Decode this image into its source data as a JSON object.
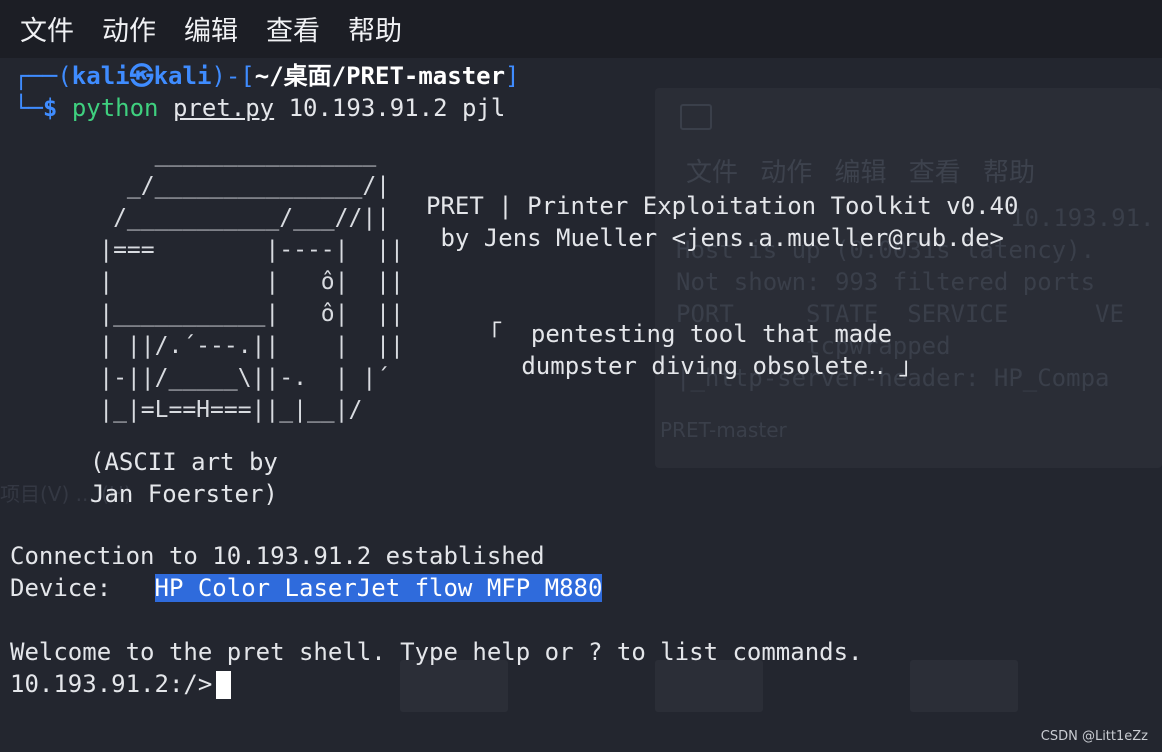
{
  "menu": [
    "文件",
    "动作",
    "编辑",
    "查看",
    "帮助"
  ],
  "prompt": {
    "open": "┌──(",
    "user": "kali",
    "at_icon": "㉿",
    "host": "kali",
    "mid": ")-[",
    "path": "~/桌面/PRET-master",
    "close": "]",
    "corner": "└─",
    "dollar": "$",
    "command": "python",
    "script": "pret.py",
    "args": "10.193.91.2 pjl"
  },
  "ascii_art": "         ________________\n       _/_______________/|\n      /___________/___//||\n     |===        |----|  ||\n     |           |   ô|  ||\n     |___________|   ô|  ||\n     | ||/.´---.||    |  ||\n     |-||/_____\\||-.  | |´\n     |_|=L==H===||_|__|/",
  "banner": {
    "title": "PRET | Printer Exploitation Toolkit v0.40",
    "author": " by Jens Mueller <jens.a.mueller@rub.de>"
  },
  "quote": {
    "line1": "「  pentesting tool that made",
    "line2": "   dumpster diving obsolete‥ 」"
  },
  "credit": {
    "line1": "(ASCII art by",
    "line2": "Jan Foerster)"
  },
  "connection": "Connection to 10.193.91.2 established",
  "device": {
    "label": "Device:   ",
    "value": "HP Color LaserJet flow MFP M880"
  },
  "welcome": "Welcome to the pret shell. Type help or ? to list commands.",
  "shell_prompt": "10.193.91.2:/>",
  "watermark": "CSDN @Litt1eZz",
  "background_window": {
    "menu": "文件  动作  编辑  查看  帮助",
    "lines": [
      "10.193.91.",
      "Host is up (0.0031s latency).",
      "Not shown: 993 filtered ports",
      "PORT     STATE  SERVICE      VE",
      "         tcpwrapped",
      "|_http-server-header: HP_Compa"
    ],
    "folder": "PRET-master",
    "left_text": "项目(V)  ...  (H)"
  }
}
